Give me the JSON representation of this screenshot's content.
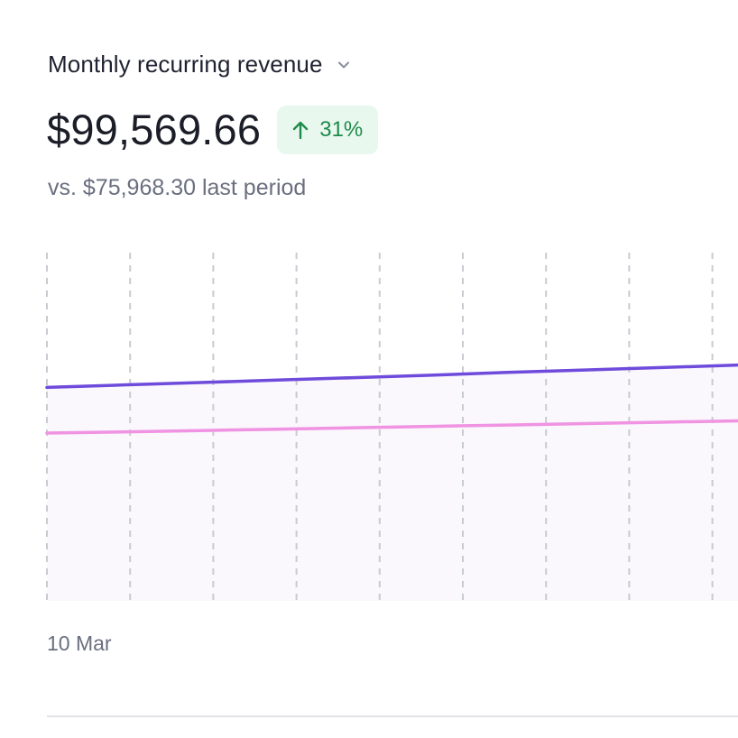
{
  "metric": {
    "title": "Monthly recurring revenue",
    "dropdown_icon": "chevron-down-icon",
    "value": "$99,569.66",
    "delta": {
      "icon": "arrow-up-icon",
      "text": "31%",
      "background": "#e9f8ef",
      "color": "#1f8b4a"
    },
    "comparison": "vs. $75,968.30 last period"
  },
  "chart_data": {
    "type": "area",
    "x_tick_labels": [
      "10 Mar"
    ],
    "grid": {
      "vertical_dashed": true
    },
    "series": [
      {
        "key": "current",
        "color": "#6e4bdb",
        "values": [
          0.613,
          0.62,
          0.627,
          0.634,
          0.641,
          0.648,
          0.656,
          0.663,
          0.67,
          0.677
        ],
        "fill": "#faf7fd"
      },
      {
        "key": "previous",
        "color": "#f093e2",
        "values": [
          0.482,
          0.485,
          0.489,
          0.493,
          0.497,
          0.501,
          0.505,
          0.509,
          0.513,
          0.517
        ]
      }
    ],
    "ylim": [
      0,
      1
    ]
  }
}
